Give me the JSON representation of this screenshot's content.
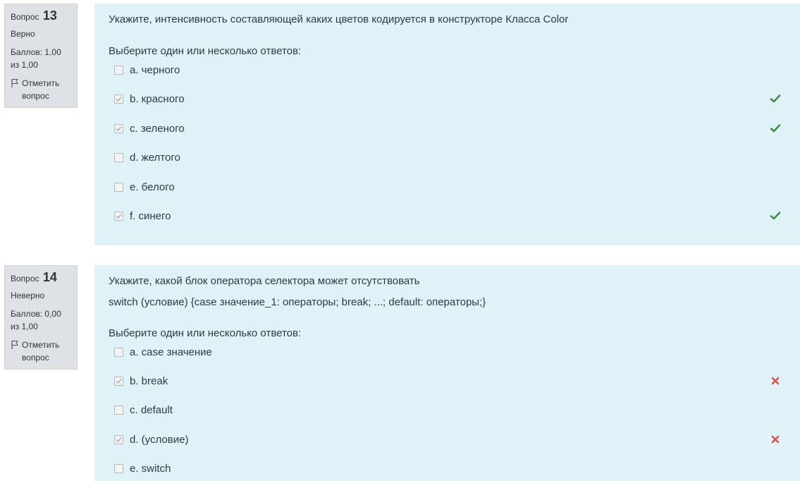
{
  "questions": [
    {
      "label": "Вопрос",
      "number": "13",
      "state": "Верно",
      "grade": "Баллов: 1,00 из 1,00",
      "flag": "Отметить вопрос",
      "text": "Укажите, интенсивность составляющей каких цветов кодируется в конструкторе Класса Color",
      "code": "",
      "prompt": "Выберите один или несколько ответов:",
      "answers": [
        {
          "text": "a. черного",
          "checked": false,
          "mark": ""
        },
        {
          "text": "b. красного",
          "checked": true,
          "mark": "correct"
        },
        {
          "text": "c. зеленого",
          "checked": true,
          "mark": "correct"
        },
        {
          "text": "d. желтого",
          "checked": false,
          "mark": ""
        },
        {
          "text": "e. белого",
          "checked": false,
          "mark": ""
        },
        {
          "text": "f. синего",
          "checked": true,
          "mark": "correct"
        }
      ]
    },
    {
      "label": "Вопрос",
      "number": "14",
      "state": "Неверно",
      "grade": "Баллов: 0,00 из 1,00",
      "flag": "Отметить вопрос",
      "text": "Укажите, какой блок оператора селектора может отсутствовать",
      "code": "switch (условие) {case значение_1: операторы; break; ...; default: операторы;}",
      "prompt": "Выберите один или несколько ответов:",
      "answers": [
        {
          "text": "a. case значение",
          "checked": false,
          "mark": ""
        },
        {
          "text": "b. break",
          "checked": true,
          "mark": "incorrect"
        },
        {
          "text": "c. default",
          "checked": false,
          "mark": ""
        },
        {
          "text": "d. (условие)",
          "checked": true,
          "mark": "incorrect"
        },
        {
          "text": "e. switch",
          "checked": false,
          "mark": ""
        }
      ]
    }
  ],
  "colors": {
    "content_bg": "#def2f8",
    "info_bg": "#dee2e6",
    "correct": "#3f8f3f",
    "incorrect": "#d9534f"
  },
  "icons": {
    "flag": "flag-icon",
    "correct": "check-icon",
    "incorrect": "cross-icon"
  }
}
